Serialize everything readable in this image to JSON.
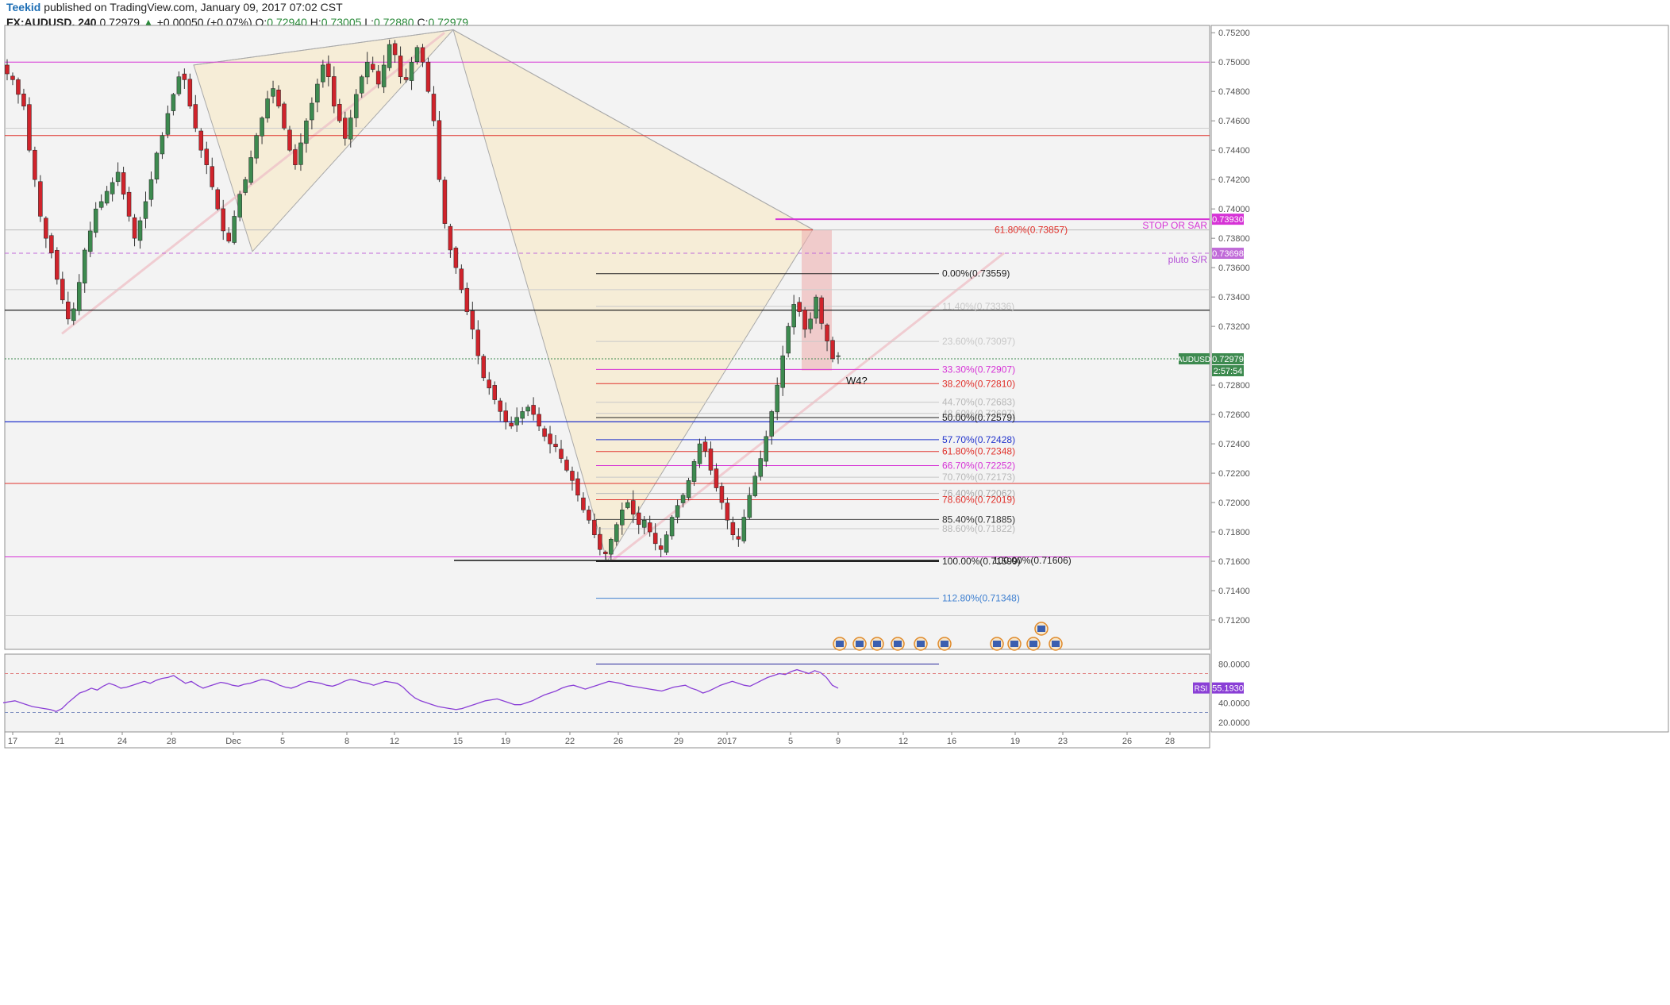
{
  "header": {
    "author": "Teekid",
    "published": "published on TradingView.com, January 09, 2017 07:02 CST",
    "symbol": "FX:AUDUSD, 240",
    "last": "0.72979",
    "change": "+0.00050 (+0.07%)",
    "o_label": "O:",
    "o": "0.72940",
    "h_label": "H:",
    "h": "0.73005",
    "l_label": "L:",
    "l": "0.72880",
    "c_label": "C:",
    "c": "0.72979"
  },
  "colors": {
    "bull": "#3d8a4f",
    "bear": "#d0232b",
    "magenta": "#d633d6",
    "red": "#e0312b",
    "blue": "#2233cc",
    "pattern_fill": "#f6ecd4",
    "rsi": "#8a3fd6"
  },
  "chart_data": [
    {
      "type": "candlestick",
      "symbol": "AUDUSD",
      "timeframe": "240",
      "y_ticks": [
        "0.75200",
        "0.75000",
        "0.74800",
        "0.74600",
        "0.74400",
        "0.74200",
        "0.74000",
        "0.73800",
        "0.73600",
        "0.73400",
        "0.73200",
        "0.72800",
        "0.72600",
        "0.72400",
        "0.72200",
        "0.72000",
        "0.71800",
        "0.71600",
        "0.71400",
        "0.71200"
      ],
      "x_ticks": [
        "17",
        "21",
        "24",
        "28",
        "Dec",
        "5",
        "8",
        "12",
        "15",
        "19",
        "22",
        "26",
        "29",
        "2017",
        "5",
        "9",
        "12",
        "16",
        "19",
        "23",
        "26",
        "28"
      ],
      "ylim": [
        0.71,
        0.7525
      ],
      "close_path": [
        0.7492,
        0.7488,
        0.7478,
        0.747,
        0.744,
        0.742,
        0.7395,
        0.738,
        0.737,
        0.7352,
        0.7338,
        0.7325,
        0.7332,
        0.735,
        0.7372,
        0.7385,
        0.74,
        0.7405,
        0.7412,
        0.7418,
        0.7425,
        0.741,
        0.7395,
        0.738,
        0.7392,
        0.7405,
        0.742,
        0.7438,
        0.745,
        0.7465,
        0.7478,
        0.749,
        0.7488,
        0.747,
        0.7455,
        0.744,
        0.743,
        0.7415,
        0.74,
        0.7385,
        0.7378,
        0.7395,
        0.741,
        0.742,
        0.7435,
        0.745,
        0.7462,
        0.7475,
        0.7482,
        0.747,
        0.7455,
        0.744,
        0.743,
        0.7445,
        0.746,
        0.7472,
        0.7485,
        0.7498,
        0.749,
        0.747,
        0.746,
        0.7448,
        0.7462,
        0.7478,
        0.749,
        0.75,
        0.7495,
        0.7485,
        0.7498,
        0.7512,
        0.7505,
        0.749,
        0.7488,
        0.75,
        0.751,
        0.75,
        0.748,
        0.746,
        0.742,
        0.739,
        0.7372,
        0.736,
        0.7345,
        0.733,
        0.7318,
        0.73,
        0.7285,
        0.7278,
        0.727,
        0.7262,
        0.7255,
        0.7252,
        0.7258,
        0.7262,
        0.7265,
        0.726,
        0.7252,
        0.7245,
        0.724,
        0.7238,
        0.723,
        0.7222,
        0.7215,
        0.7205,
        0.7195,
        0.7188,
        0.7178,
        0.7168,
        0.7165,
        0.7175,
        0.7185,
        0.7195,
        0.72,
        0.7192,
        0.7185,
        0.7188,
        0.718,
        0.7172,
        0.7168,
        0.7178,
        0.719,
        0.7198,
        0.7205,
        0.7215,
        0.7228,
        0.724,
        0.7235,
        0.7222,
        0.721,
        0.72,
        0.7188,
        0.7178,
        0.7175,
        0.719,
        0.7205,
        0.7218,
        0.723,
        0.7245,
        0.7262,
        0.728,
        0.73,
        0.732,
        0.7335,
        0.733,
        0.7318,
        0.7325,
        0.734,
        0.7322,
        0.731,
        0.7298,
        0.73
      ],
      "close_last": 0.72979,
      "annotations": [
        "W4?"
      ],
      "price_labels": [
        {
          "text": "STOP OR SAR",
          "value": "0.73930"
        },
        {
          "text": "pluto S/R",
          "value": "0.73698"
        },
        {
          "text": "AUDUSD",
          "value": "0.72979"
        },
        {
          "text": "",
          "value": "2:57:54"
        }
      ],
      "fib_levels": [
        {
          "label": "61.80%(0.73857)",
          "price": 0.73857
        },
        {
          "label": "0.00%(0.73559)",
          "price": 0.73559
        },
        {
          "label": "11.40%(0.73336)",
          "price": 0.73336
        },
        {
          "label": "23.60%(0.73097)",
          "price": 0.73097
        },
        {
          "label": "33.30%(0.72907)",
          "price": 0.72907
        },
        {
          "label": "38.20%(0.72810)",
          "price": 0.7281
        },
        {
          "label": "44.70%(0.72683)",
          "price": 0.72683
        },
        {
          "label": "48.60%(0.72607)",
          "price": 0.72607
        },
        {
          "label": "50.00%(0.72579)",
          "price": 0.72579
        },
        {
          "label": "57.70%(0.72428)",
          "price": 0.72428
        },
        {
          "label": "61.80%(0.72348)",
          "price": 0.72348
        },
        {
          "label": "66.70%(0.72252)",
          "price": 0.72252
        },
        {
          "label": "70.70%(0.72173)",
          "price": 0.72173
        },
        {
          "label": "76.40%(0.72062)",
          "price": 0.72062
        },
        {
          "label": "78.60%(0.72019)",
          "price": 0.72019
        },
        {
          "label": "85.40%(0.71885)",
          "price": 0.71885
        },
        {
          "label": "88.60%(0.71822)",
          "price": 0.71822
        },
        {
          "label": "100.00%(0.71599)",
          "price": 0.71599
        },
        {
          "label": "100.00%(0.71606)",
          "price": 0.71606
        },
        {
          "label": "112.80%(0.71348)",
          "price": 0.71348
        }
      ],
      "horizontal_levels": [
        {
          "price": 0.75
        },
        {
          "price": 0.745
        },
        {
          "price": 0.7393
        },
        {
          "price": 0.73698
        },
        {
          "price": 0.7331
        },
        {
          "price": 0.7255
        },
        {
          "price": 0.7213
        },
        {
          "price": 0.7163
        }
      ]
    },
    {
      "type": "line",
      "title": "RSI",
      "value_label": "55.1930",
      "y_ticks": [
        "80.0000",
        "40.0000",
        "20.0000"
      ],
      "ylim": [
        10,
        90
      ],
      "values": [
        40,
        41,
        42,
        40,
        38,
        36,
        35,
        34,
        33,
        31,
        34,
        40,
        45,
        50,
        52,
        55,
        53,
        57,
        60,
        58,
        55,
        56,
        58,
        60,
        62,
        60,
        63,
        65,
        66,
        68,
        64,
        60,
        62,
        58,
        55,
        57,
        59,
        61,
        60,
        58,
        57,
        59,
        60,
        62,
        64,
        63,
        61,
        58,
        56,
        55,
        57,
        60,
        62,
        61,
        60,
        58,
        57,
        59,
        62,
        64,
        63,
        61,
        60,
        58,
        60,
        62,
        61,
        60,
        56,
        50,
        45,
        42,
        40,
        38,
        36,
        35,
        34,
        33,
        34,
        36,
        38,
        40,
        42,
        43,
        44,
        42,
        40,
        38,
        38,
        40,
        42,
        45,
        48,
        50,
        52,
        55,
        57,
        58,
        56,
        54,
        56,
        58,
        60,
        62,
        61,
        60,
        58,
        57,
        56,
        55,
        54,
        53,
        52,
        54,
        56,
        57,
        58,
        55,
        53,
        50,
        52,
        55,
        58,
        60,
        62,
        60,
        58,
        57,
        60,
        63,
        66,
        68,
        70,
        69,
        72,
        74,
        72,
        70,
        73,
        71,
        66,
        58,
        55
      ]
    }
  ]
}
